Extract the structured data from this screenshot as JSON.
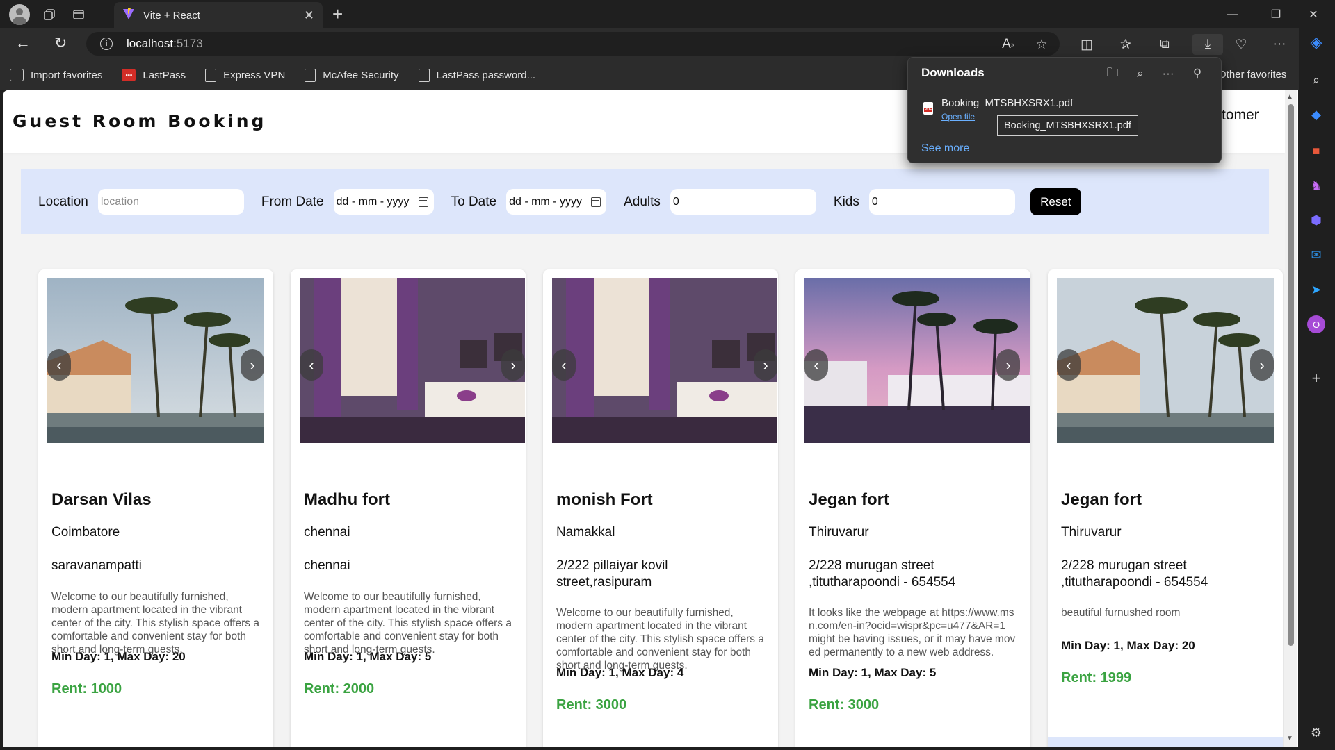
{
  "browser": {
    "tab_title": "Vite + React",
    "url_host": "localhost",
    "url_port": ":5173",
    "favorites": [
      {
        "label": "Import favorites"
      },
      {
        "label": "LastPass"
      },
      {
        "label": "Express VPN"
      },
      {
        "label": "McAfee Security"
      },
      {
        "label": "LastPass password..."
      }
    ],
    "other_favorites": "Other favorites"
  },
  "downloads": {
    "title": "Downloads",
    "file_name": "Booking_MTSBHXSRX1.pdf",
    "open_file": "Open file",
    "tooltip": "Booking_MTSBHXSRX1.pdf",
    "see_more": "See more"
  },
  "app": {
    "brand": "Guest Room Booking",
    "header_right": "tomer"
  },
  "filters": {
    "location_label": "Location",
    "location_placeholder": "location",
    "from_label": "From Date",
    "from_value": "dd - mm - yyyy",
    "to_label": "To Date",
    "to_value": "dd - mm - yyyy",
    "adults_label": "Adults",
    "adults_value": "0",
    "kids_label": "Kids",
    "kids_value": "0",
    "reset": "Reset"
  },
  "cards": [
    {
      "title": "Darsan Vilas",
      "city": "Coimbatore",
      "address": "saravanampatti",
      "description": "Welcome to our beautifully furnished, modern apartment located in the vibrant center of the city. This stylish space offers a comfortable and convenient stay for both short and long-term guests.",
      "days": "Min Day: 1, Max Day: 20",
      "rent": "Rent: 1000",
      "image": "resort-palms"
    },
    {
      "title": "Madhu fort",
      "city": "chennai",
      "address": "chennai",
      "description": "Welcome to our beautifully furnished, modern apartment located in the vibrant center of the city. This stylish space offers a comfortable and convenient stay for both short and long-term guests.",
      "days": "Min Day: 1, Max Day: 5",
      "rent": "Rent: 2000",
      "image": "purple-bedroom"
    },
    {
      "title": "monish Fort",
      "city": "Namakkal",
      "address": "2/222 pillaiyar kovil street,rasipuram",
      "description": "Welcome to our beautifully furnished, modern apartment located in the vibrant center of the city. This stylish space offers a comfortable and convenient stay for both short and long-term guests.",
      "days": "Min Day: 1, Max Day: 4",
      "rent": "Rent: 3000",
      "image": "purple-bedroom"
    },
    {
      "title": "Jegan fort",
      "city": "Thiruvarur",
      "address": "2/228 murugan street ,titutharapoondi - 654554",
      "description": "It looks like the webpage at https://www.msn.com/en-in?ocid=wispr&pc=u477&AR=1 might be having issues, or it may have moved permanently to a new web address.",
      "days": "Min Day: 1, Max Day: 5",
      "rent": "Rent: 3000",
      "image": "pool-dusk"
    },
    {
      "title": "Jegan fort",
      "city": "Thiruvarur",
      "address": "2/228 murugan street ,titutharapoondi - 654554",
      "description": "beautiful furnushed room",
      "days": "Min Day: 1, Max Day: 20",
      "rent": "Rent: 1999",
      "book": "Book",
      "image": "resort-palms"
    }
  ],
  "colors": {
    "accent_green": "#3aa341",
    "filter_bg": "#dde6fb",
    "link_blue": "#6ab0ff"
  }
}
